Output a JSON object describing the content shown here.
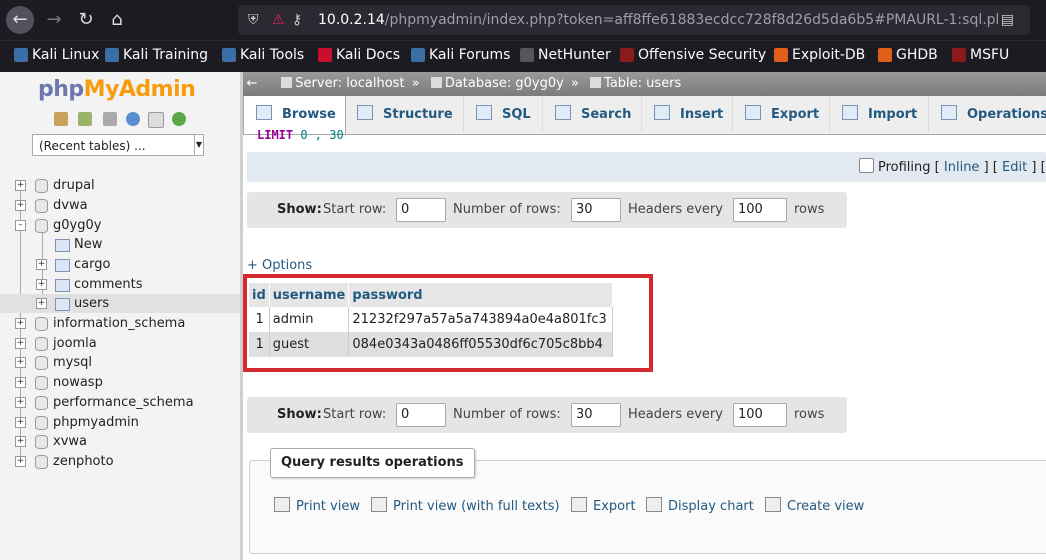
{
  "browser": {
    "url_host": "10.0.2.14",
    "url_rest": "/phpmyadmin/index.php?token=aff8ffe61883ecdcc728f8d26d5da6b5#PMAURL-1:sql.ph",
    "bookmarks": [
      "Kali Linux",
      "Kali Training",
      "Kali Tools",
      "Kali Docs",
      "Kali Forums",
      "NetHunter",
      "Offensive Security",
      "Exploit-DB",
      "GHDB",
      "MSFU"
    ]
  },
  "nav": {
    "logo_php": "php",
    "logo_my": "MyAdmin",
    "recent_tables": "(Recent tables) ...",
    "tree": {
      "drupal": "drupal",
      "dvwa": "dvwa",
      "g0yg0y": "g0yg0y",
      "new": "New",
      "cargo": "cargo",
      "comments": "comments",
      "users": "users",
      "information_schema": "information_schema",
      "joomla": "joomla",
      "mysql": "mysql",
      "nowasp": "nowasp",
      "performance_schema": "performance_schema",
      "phpmyadmin": "phpmyadmin",
      "xvwa": "xvwa",
      "zenphoto": "zenphoto"
    }
  },
  "breadcrumb": {
    "server": "Server: localhost",
    "database": "Database: g0yg0y",
    "table": "Table: users",
    "sep": "»"
  },
  "tabs": [
    "Browse",
    "Structure",
    "SQL",
    "Search",
    "Insert",
    "Export",
    "Import",
    "Operations"
  ],
  "query": {
    "limit_kw": "LIMIT",
    "limit_vals": "0 , 30"
  },
  "profiling": {
    "label": "Profiling",
    "open1": "[",
    "inline": "Inline",
    "close1": "]",
    "open2": "[",
    "edit": "Edit",
    "close2": "]",
    "open3": "["
  },
  "show": {
    "show_label": "Show",
    "colon": ":",
    "start_row_label": "Start row:",
    "start_row": "0",
    "num_rows_label": "Number of rows:",
    "num_rows": "30",
    "headers_label": "Headers every",
    "headers_every": "100",
    "rows_label": "rows"
  },
  "options_link": "+ Options",
  "results": {
    "headers": [
      "id",
      "username",
      "password"
    ],
    "rows": [
      [
        "1",
        "admin",
        "21232f297a57a5a743894a0e4a801fc3"
      ],
      [
        "1",
        "guest",
        "084e0343a0486ff05530df6c705c8bb4"
      ]
    ]
  },
  "query_ops": {
    "title": "Query results operations",
    "links": [
      "Print view",
      "Print view (with full texts)",
      "Export",
      "Display chart",
      "Create view"
    ]
  },
  "colors": {
    "link": "#235a81",
    "highlight_border": "#d42a2f",
    "chrome_bg": "#1c1b22"
  }
}
